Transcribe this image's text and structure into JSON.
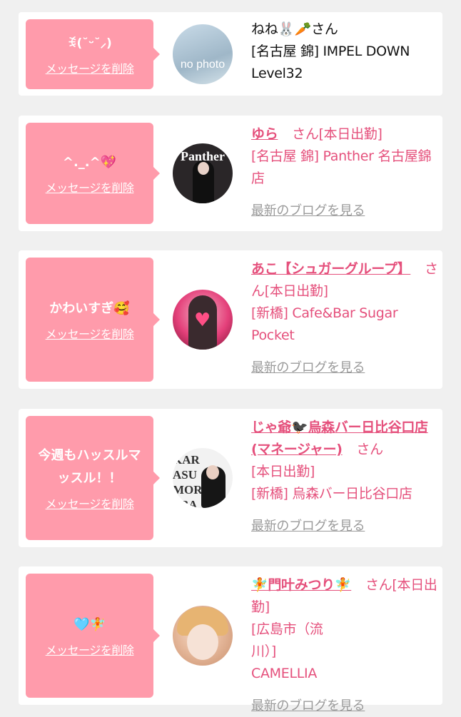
{
  "colors": {
    "bubble": "#ff9bab",
    "accent": "#e5507c",
    "muted": "#9a9a9a"
  },
  "delete_label": "メッセージを削除",
  "blog_label": "最新のブログを見る",
  "entries": [
    {
      "message": "ꉂ(˘ᵕ˘⸝)",
      "name": "ねね🐰🥕",
      "san": "さん",
      "working": "",
      "shop": "[名古屋 錦] IMPEL DOWN Level32",
      "avatar_text": "no photo",
      "has_blog": false
    },
    {
      "message": "^._.^💖",
      "name": "ゆら",
      "san": "さん",
      "working": "[本日出勤]",
      "shop": "[名古屋 錦] Panther 名古屋錦店",
      "avatar_text": "Panther",
      "has_blog": true
    },
    {
      "message": "かわいすぎ🥰",
      "name": "あこ【シュガーグループ】",
      "san": "さん",
      "working": "[本日出勤]",
      "shop": "[新橋] Cafe&Bar Sugar Pocket",
      "avatar_text": "",
      "has_blog": true
    },
    {
      "message": "今週もハッスルマッスル！！",
      "name": "じゃ爺🐦‍⬛烏森バー日比谷口店(マネージャー)",
      "san": "さん",
      "working": "[本日出勤]",
      "shop": "[新橋] 烏森バー日比谷口店",
      "avatar_text": "KARASU MORI BAR",
      "has_blog": true
    },
    {
      "message": "🩵🧚",
      "name": "🧚門叶みつり🧚",
      "san": "さん",
      "working": "[本日出勤]",
      "shop": "[広島市（流川）] CAMELLIA",
      "avatar_text": "",
      "has_blog": true
    }
  ]
}
